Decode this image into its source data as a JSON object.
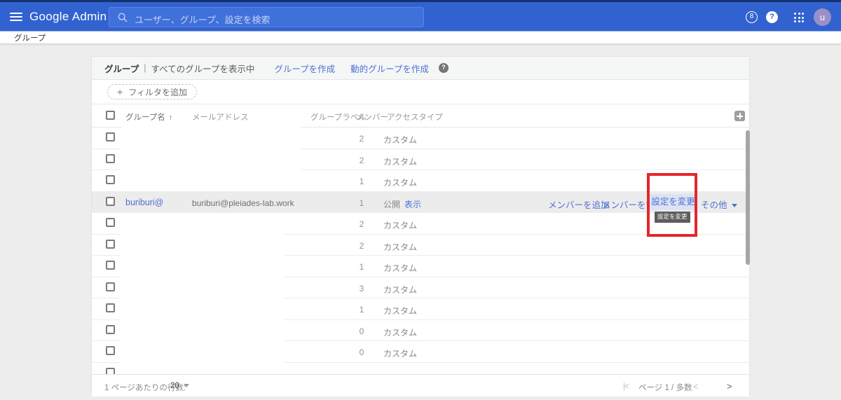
{
  "topbar": {
    "product_name": "Google Admin",
    "search_placeholder": "ユーザー、グループ、設定を検索",
    "alerts_count": "8",
    "help_glyph": "?",
    "avatar_letter": "u"
  },
  "breadcrumb": {
    "label": "グループ"
  },
  "panel": {
    "title": "グループ",
    "separator": "|",
    "filter_status": "すべてのグループを表示中",
    "create_group_link": "グループを作成",
    "create_dynamic_group_link": "動的グループを作成",
    "help_glyph": "?",
    "add_filter_plus": "+",
    "add_filter_label": "フィルタを追加",
    "columns": {
      "name": "グループ名",
      "sort_arrow": "↑",
      "email": "メールアドレス",
      "label": "グループラベル",
      "members": "メンバー",
      "access_type": "アクセスタイプ"
    },
    "rows": [
      {
        "members": "2",
        "access": "カスタム"
      },
      {
        "members": "2",
        "access": "カスタム"
      },
      {
        "members": "1",
        "access": "カスタム"
      },
      {
        "name": "buriburi@",
        "email": "buriburi@pleiades-lab.work",
        "members": "1",
        "access": "公開",
        "access_link": "表示",
        "actions": {
          "add": "メンバーを追加",
          "manage": "メンバーを管理",
          "settings": "設定を変更",
          "more": "その他"
        }
      },
      {
        "members": "2",
        "access": "カスタム"
      },
      {
        "members": "2",
        "access": "カスタム"
      },
      {
        "members": "1",
        "access": "カスタム"
      },
      {
        "members": "3",
        "access": "カスタム"
      },
      {
        "members": "1",
        "access": "カスタム"
      },
      {
        "members": "0",
        "access": "カスタム"
      },
      {
        "members": "0",
        "access": "カスタム"
      }
    ],
    "tooltip": "設定を変更"
  },
  "footer": {
    "rows_per_page_label": "1 ページあたりの行数:",
    "rows_per_page_value": "20",
    "first_page_icon": "|<",
    "page_status": "ページ 1 / 多数",
    "prev_icon": "<",
    "next_icon": ">"
  },
  "colors": {
    "appbar_blue": "#3162cf",
    "link_blue": "#4e71d4",
    "row_hover_gray": "#ececec",
    "settings_highlight": "#dce2f4",
    "annotation_red": "#e3262c",
    "tooltip_gray": "#5d5d5d",
    "page_background": "#ededee"
  }
}
